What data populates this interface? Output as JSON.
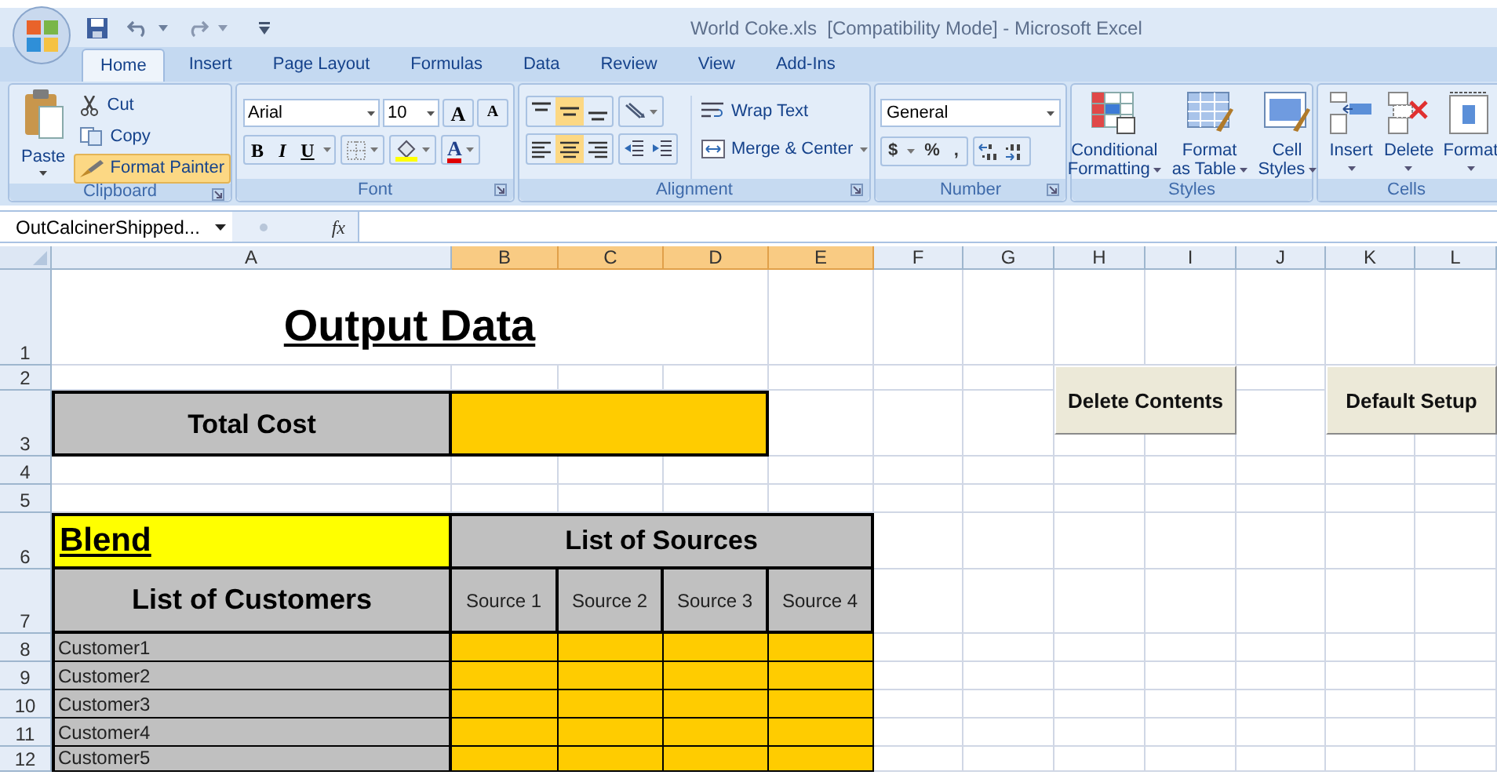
{
  "title_bar": {
    "title": "World Coke.xls  [Compatibility Mode] - Microsoft Excel"
  },
  "ribbon_tabs": [
    {
      "label": "Home",
      "selected": true
    },
    {
      "label": "Insert",
      "selected": false
    },
    {
      "label": "Page Layout",
      "selected": false
    },
    {
      "label": "Formulas",
      "selected": false
    },
    {
      "label": "Data",
      "selected": false
    },
    {
      "label": "Review",
      "selected": false
    },
    {
      "label": "View",
      "selected": false
    },
    {
      "label": "Add-Ins",
      "selected": false
    }
  ],
  "clipboard": {
    "label": "Clipboard",
    "paste": "Paste",
    "cut": "Cut",
    "copy": "Copy",
    "format_painter": {
      "label": "Format Painter",
      "on": true
    }
  },
  "font": {
    "label": "Font",
    "font_name": "Arial",
    "font_size": "10",
    "grow": "A",
    "shrink": "A",
    "bold": "B",
    "italic": "I",
    "underline": "U",
    "font_color": "A"
  },
  "alignment": {
    "label": "Alignment",
    "vertical": [
      {
        "selected": false
      },
      {
        "selected": true
      },
      {
        "selected": false
      }
    ],
    "horizontal": [
      {
        "selected": false
      },
      {
        "selected": true
      },
      {
        "selected": false
      }
    ],
    "wrap_text": "Wrap Text",
    "merge_center": "Merge & Center"
  },
  "number": {
    "label": "Number",
    "format": "General",
    "currency": "$",
    "percent": "%",
    "comma": ","
  },
  "styles": {
    "label": "Styles",
    "buttons": [
      {
        "lines": [
          "Conditional",
          "Formatting"
        ]
      },
      {
        "lines": [
          "Format",
          "as Table"
        ]
      },
      {
        "lines": [
          "Cell",
          "Styles"
        ]
      }
    ]
  },
  "cells": {
    "label": "Cells",
    "buttons": [
      "Insert",
      "Delete",
      "Format"
    ]
  },
  "formula_bar": {
    "name_box": "OutCalcinerShipped...",
    "function_label": "fx"
  },
  "sheet": {
    "columns": [
      {
        "label": "A",
        "selected": false
      },
      {
        "label": "B",
        "selected": true
      },
      {
        "label": "C",
        "selected": true
      },
      {
        "label": "D",
        "selected": true
      },
      {
        "label": "E",
        "selected": true
      },
      {
        "label": "F",
        "selected": false
      },
      {
        "label": "G",
        "selected": false
      },
      {
        "label": "H",
        "selected": false
      },
      {
        "label": "I",
        "selected": false
      },
      {
        "label": "J",
        "selected": false
      },
      {
        "label": "K",
        "selected": false
      },
      {
        "label": "L",
        "selected": false
      }
    ],
    "row_numbers": [
      "1",
      "2",
      "3",
      "4",
      "5",
      "6",
      "7",
      "8",
      "9",
      "10",
      "11",
      "12"
    ],
    "title": "Output Data",
    "total_cost_label": "Total Cost",
    "blend_label": "Blend",
    "sources_header": "List of Sources",
    "customers_header": "List of Customers",
    "sources": [
      "Source 1",
      "Source 2",
      "Source 3",
      "Source 4"
    ],
    "customers": [
      "Customer1",
      "Customer2",
      "Customer3",
      "Customer4",
      "Customer5"
    ]
  },
  "buttons": [
    {
      "label": "Delete Contents"
    },
    {
      "label": "Default Setup"
    }
  ]
}
